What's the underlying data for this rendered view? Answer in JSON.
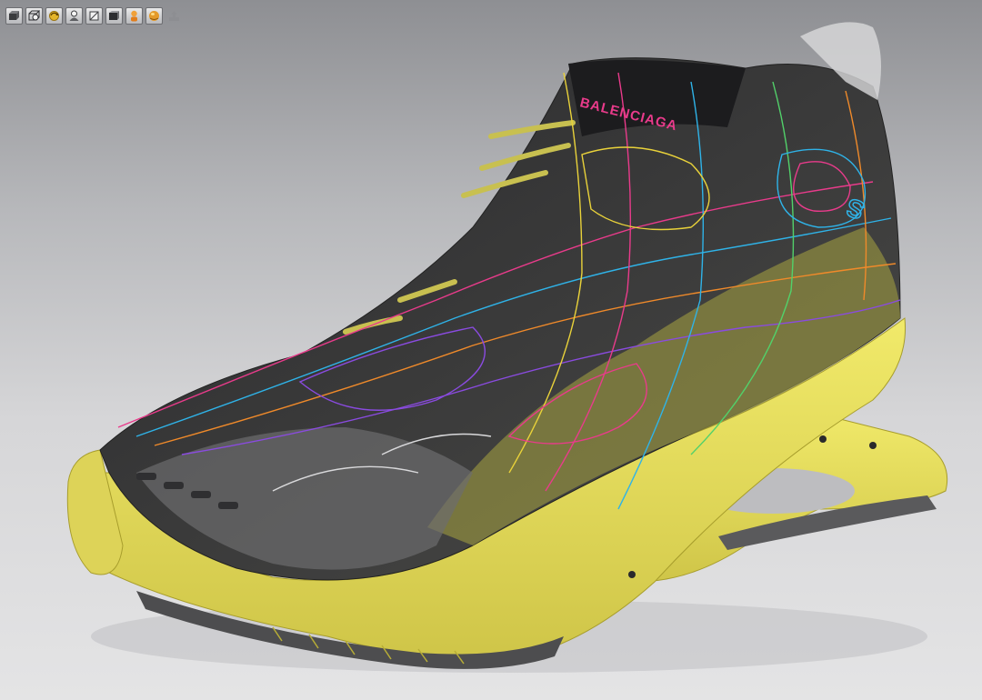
{
  "viewer": {
    "background_top": "#8e8f93",
    "background_bottom": "#e4e4e5",
    "accent_yellow": "#e8e05a"
  },
  "toolbar": {
    "buttons": [
      {
        "icon": "shaded-view-icon"
      },
      {
        "icon": "wireframe-view-icon"
      },
      {
        "icon": "rotate-light-icon"
      },
      {
        "icon": "person-view-icon"
      },
      {
        "icon": "hidden-line-view-icon"
      },
      {
        "icon": "flat-shaded-view-icon"
      },
      {
        "icon": "user-figure-icon"
      },
      {
        "icon": "environment-sphere-icon"
      },
      {
        "icon": "export-upload-icon"
      }
    ]
  },
  "model": {
    "brand_logo_text": "BALENCIAGA",
    "heel_mark_text": "S"
  }
}
